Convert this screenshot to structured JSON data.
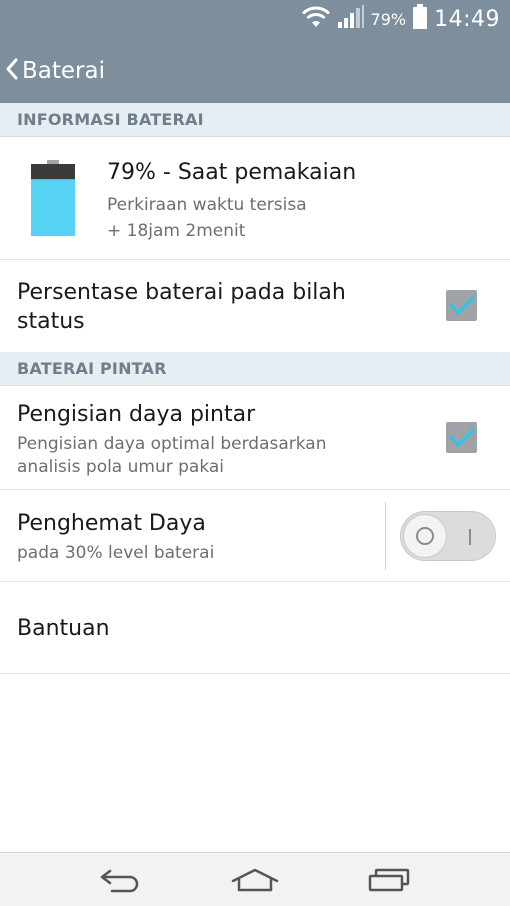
{
  "status_bar": {
    "battery_percent": "79%",
    "time": "14:49",
    "icons": [
      "wifi-icon",
      "signal-icon",
      "battery-icon"
    ]
  },
  "app_bar": {
    "back_icon": "chevron-left-icon",
    "title": "Baterai"
  },
  "sections": {
    "info_header": "INFORMASI BATERAI",
    "smart_header": "BATERAI PINTAR"
  },
  "battery_info": {
    "level": 0.79,
    "title": "79% - Saat pemakaian",
    "line1": "Perkiraan waktu tersisa",
    "line2": "+ 18jam 2menit"
  },
  "settings": {
    "percentage_status": {
      "title_line1": "Persentase baterai pada bilah",
      "title_line2": "status",
      "checked": true
    },
    "smart_charging": {
      "title": "Pengisian daya pintar",
      "sub_line1": "Pengisian daya optimal berdasarkan",
      "sub_line2": "analisis pola umur pakai",
      "checked": true
    },
    "power_saver": {
      "title": "Penghemat Daya",
      "sub": "pada 30% level baterai",
      "enabled": false
    },
    "help": {
      "title": "Bantuan"
    }
  },
  "nav_bar": {
    "icons": [
      "back-arrow-icon",
      "home-icon",
      "recent-apps-icon"
    ]
  },
  "colors": {
    "header_bg": "#7d8e9d",
    "section_bg": "#e6eef4",
    "check_accent": "#2ec4e6",
    "battery_fill": "#56d3f3"
  }
}
